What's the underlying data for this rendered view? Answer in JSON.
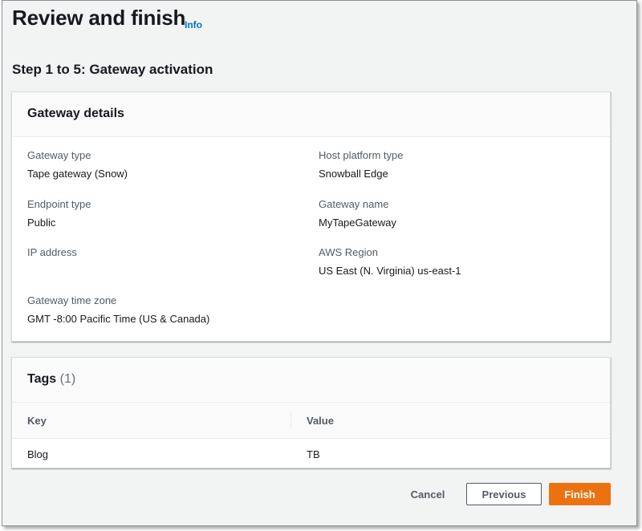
{
  "header": {
    "title": "Review and finish",
    "info_link": "Info"
  },
  "step": {
    "title": "Step 1 to 5: Gateway activation"
  },
  "gateway_details": {
    "heading": "Gateway details",
    "fields": [
      {
        "label": "Gateway type",
        "value": "Tape gateway (Snow)"
      },
      {
        "label": "Host platform type",
        "value": "Snowball Edge"
      },
      {
        "label": "Endpoint type",
        "value": "Public"
      },
      {
        "label": "Gateway name",
        "value": "MyTapeGateway"
      },
      {
        "label": "IP address",
        "value": ""
      },
      {
        "label": "AWS Region",
        "value": "US East (N. Virginia) us-east-1"
      },
      {
        "label": "Gateway time zone",
        "value": "GMT -8:00 Pacific Time (US & Canada)"
      }
    ]
  },
  "tags": {
    "heading": "Tags",
    "count": "(1)",
    "columns": [
      "Key",
      "Value"
    ],
    "rows": [
      [
        "Blog",
        "TB"
      ]
    ]
  },
  "footer": {
    "cancel_label": "Cancel",
    "previous_label": "Previous",
    "finish_label": "Finish"
  },
  "colors": {
    "primary_button": "#ec7211",
    "link": "#0073bb",
    "page_background": "#f2f3f3"
  }
}
